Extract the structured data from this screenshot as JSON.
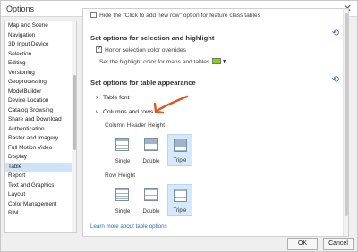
{
  "window": {
    "title": "Options",
    "close_icon": "close-icon"
  },
  "sidebar": {
    "items": [
      {
        "label": "Map and Scene"
      },
      {
        "label": "Navigation"
      },
      {
        "label": "3D Input Device"
      },
      {
        "label": "Selection"
      },
      {
        "label": "Editing"
      },
      {
        "label": "Versioning"
      },
      {
        "label": "Geoprocessing"
      },
      {
        "label": "ModelBuilder"
      },
      {
        "label": "Device Location"
      },
      {
        "label": "Catalog Browsing"
      },
      {
        "label": "Share and Download"
      },
      {
        "label": "Authentication"
      },
      {
        "label": "Raster and Imagery"
      },
      {
        "label": "Full Motion Video"
      },
      {
        "label": "Display"
      },
      {
        "label": "Table"
      },
      {
        "label": "Report"
      },
      {
        "label": "Text and Graphics"
      },
      {
        "label": "Layout"
      },
      {
        "label": "Color Management"
      },
      {
        "label": "BIM"
      }
    ],
    "selected": "Table"
  },
  "content": {
    "top_checkbox_label": "Hide the \"Click to add new row\" option for feature class tables",
    "selection_section": {
      "heading": "Set options for selection and highlight",
      "honor_label": "Honor selection color overrides",
      "honor_checked": true,
      "highlight_label": "Set the highlight color for maps and tables",
      "highlight_color": "#88d400"
    },
    "appearance_section": {
      "heading": "Set options for table appearance",
      "table_font": "Table font",
      "columns_rows": "Columns and rows",
      "column_header_height": {
        "label": "Column Header Height",
        "options": [
          "Single",
          "Double",
          "Triple"
        ],
        "selected": "Triple"
      },
      "row_height": {
        "label": "Row Height",
        "options": [
          "Single",
          "Double",
          "Triple"
        ],
        "selected": "Triple"
      }
    },
    "learn_more": "Learn more about table options"
  },
  "buttons": {
    "ok": "OK",
    "cancel": "Cancel"
  },
  "colors": {
    "accent": "#2d74c4",
    "selection": "#cfe3f8",
    "annotation": "#e2561b"
  }
}
